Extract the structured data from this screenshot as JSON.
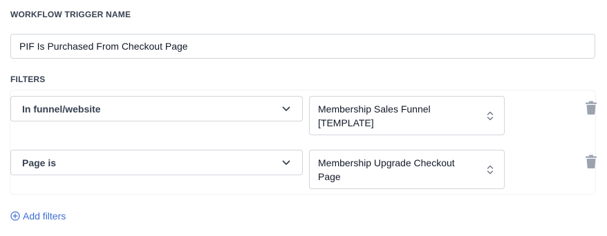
{
  "trigger": {
    "section_label": "WORKFLOW TRIGGER NAME",
    "name_value": "PIF Is Purchased From Checkout Page"
  },
  "filters": {
    "section_label": "FILTERS",
    "rows": [
      {
        "field": "In funnel/website",
        "value": "Membership Sales Funnel [TEMPLATE]"
      },
      {
        "field": "Page is",
        "value": "Membership Upgrade Checkout Page"
      }
    ],
    "add_label": "Add filters"
  },
  "icons": {
    "chevron": "chevron-down-icon",
    "updown": "updown-chevron-icon",
    "delete": "trash-icon",
    "add": "plus-circle-icon"
  },
  "colors": {
    "link": "#3b6fd4",
    "trash": "#9ca3af",
    "border": "#d1d5db"
  }
}
